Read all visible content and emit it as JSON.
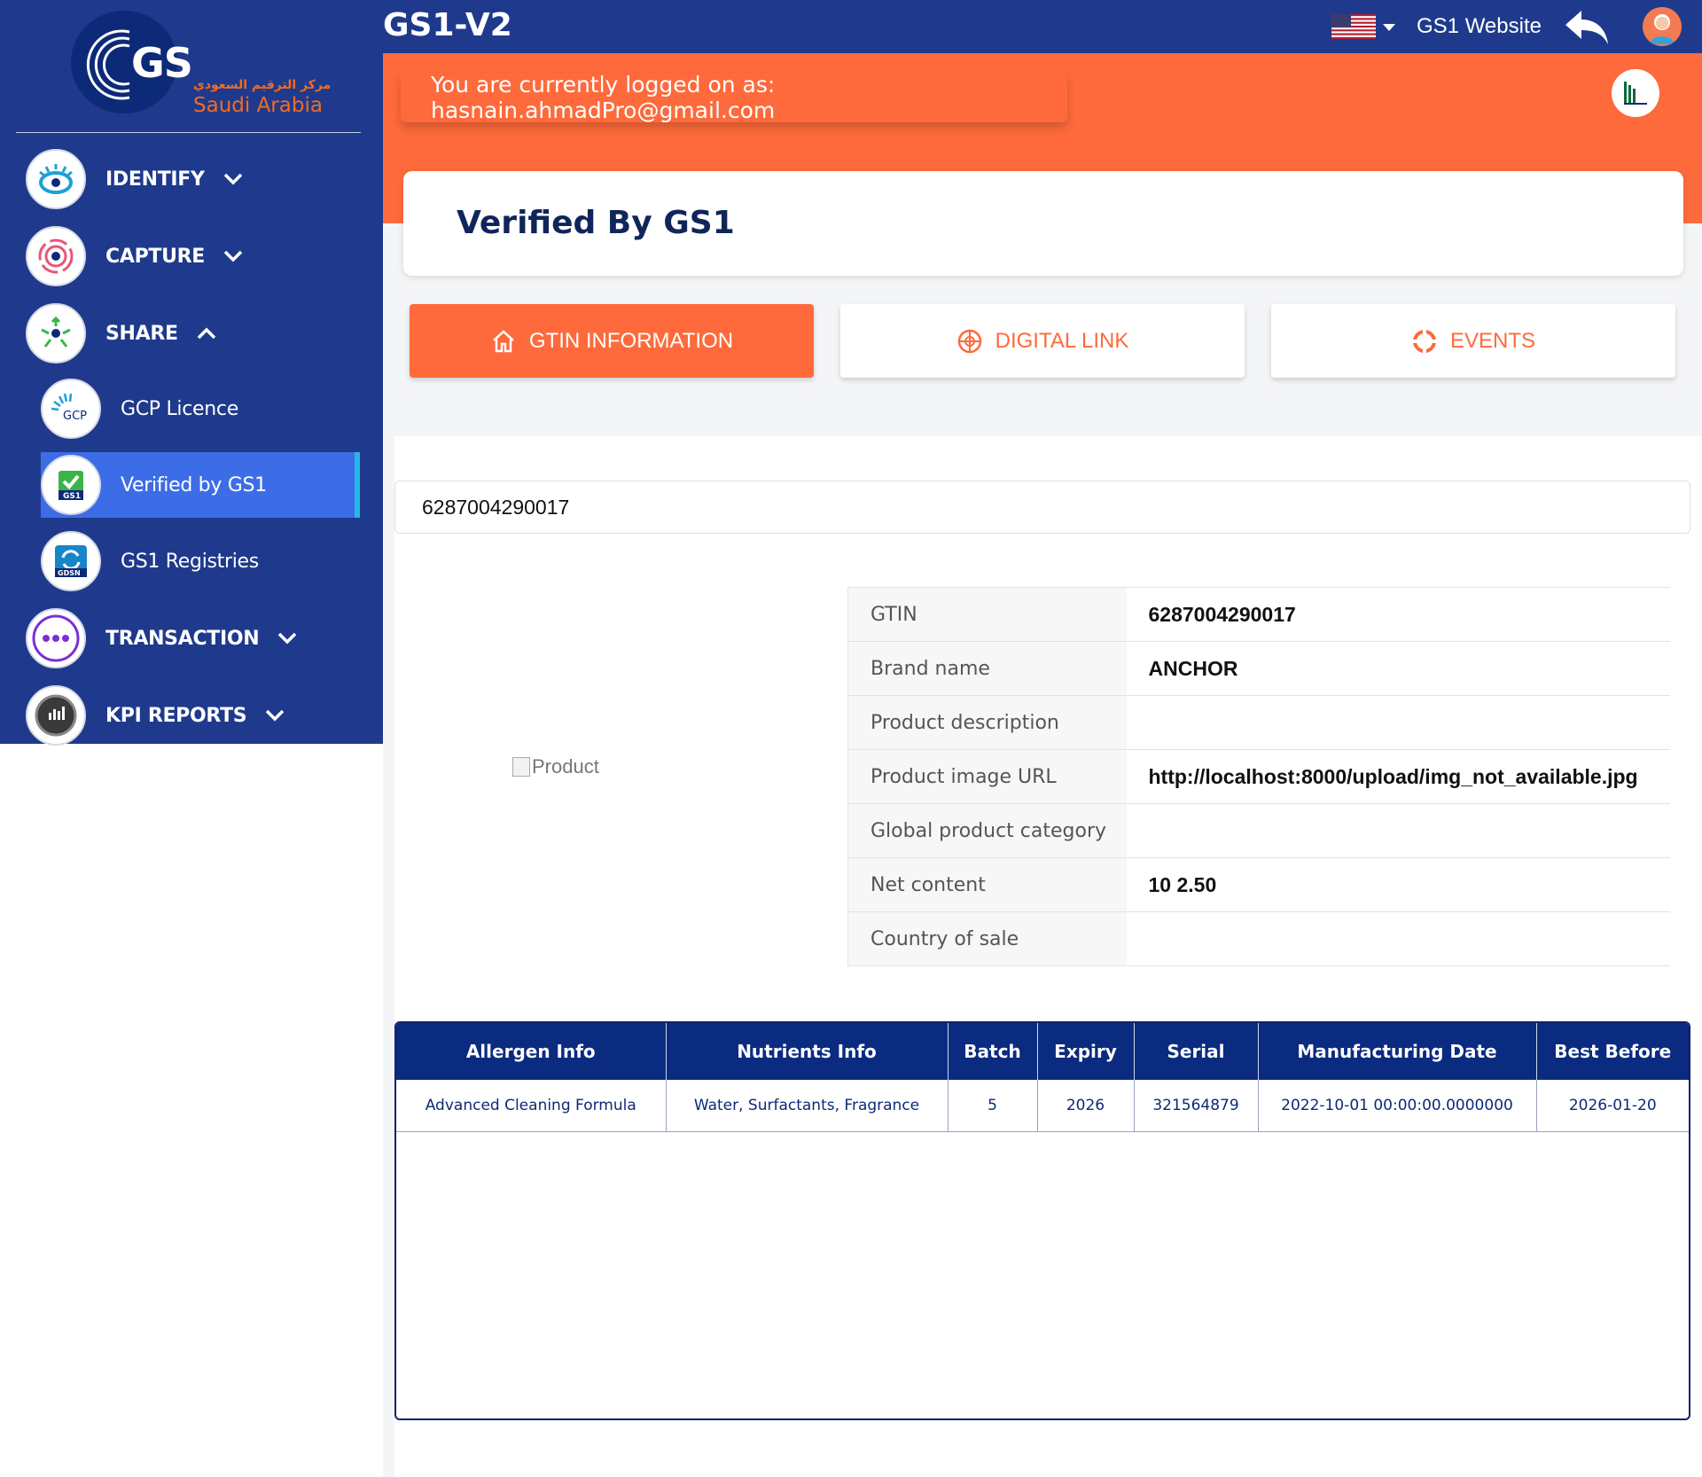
{
  "app": {
    "title": "GS1-V2",
    "site_link": "GS1 Website"
  },
  "logo": {
    "gs_text": "GS",
    "arabic": "مركز الترقيم السعودي",
    "region": "Saudi Arabia"
  },
  "sidebar": {
    "items": [
      {
        "label": "IDENTIFY",
        "icon": "eye-icon",
        "expanded": false
      },
      {
        "label": "CAPTURE",
        "icon": "target-icon",
        "expanded": false
      },
      {
        "label": "SHARE",
        "icon": "share-network-icon",
        "expanded": true
      },
      {
        "label": "TRANSACTION",
        "icon": "dots-icon",
        "expanded": false
      },
      {
        "label": "KPI REPORTS",
        "icon": "report-icon",
        "expanded": false
      }
    ],
    "share_sub": [
      {
        "label": "GCP Licence",
        "icon_text": "GCP"
      },
      {
        "label": "Verified by GS1",
        "icon_text": "GS1",
        "active": true
      },
      {
        "label": "GS1 Registries",
        "icon_text": "GDSN"
      }
    ]
  },
  "banner": {
    "login_text": "You are currently logged on as: hasnain.ahmadPro@gmail.com"
  },
  "page": {
    "title": "Verified By GS1"
  },
  "tabs": [
    {
      "label": "GTIN INFORMATION",
      "icon": "home-icon",
      "active": true
    },
    {
      "label": "DIGITAL LINK",
      "icon": "link-globe-icon",
      "active": false
    },
    {
      "label": "EVENTS",
      "icon": "events-icon",
      "active": false
    }
  ],
  "search": {
    "value": "6287004290017"
  },
  "product": {
    "image_alt": "Product"
  },
  "info_rows": [
    {
      "key": "GTIN",
      "value": "6287004290017"
    },
    {
      "key": "Brand name",
      "value": "ANCHOR"
    },
    {
      "key": "Product description",
      "value": ""
    },
    {
      "key": "Product image URL",
      "value": "http://localhost:8000/upload/img_not_available.jpg"
    },
    {
      "key": "Global product category",
      "value": ""
    },
    {
      "key": "Net content",
      "value": "10 2.50"
    },
    {
      "key": "Country of sale",
      "value": ""
    }
  ],
  "batch_table": {
    "headers": [
      "Allergen Info",
      "Nutrients Info",
      "Batch",
      "Expiry",
      "Serial",
      "Manufacturing Date",
      "Best Before"
    ],
    "rows": [
      [
        "Advanced Cleaning Formula",
        "Water, Surfactants, Fragrance",
        "5",
        "2026",
        "321564879",
        "2022-10-01 00:00:00.0000000",
        "2026-01-20"
      ]
    ]
  },
  "colors": {
    "navy": "#1f3a8c",
    "orange": "#fe6a3b",
    "active_blue": "#3d6de6",
    "table_header": "#0b2b80"
  }
}
